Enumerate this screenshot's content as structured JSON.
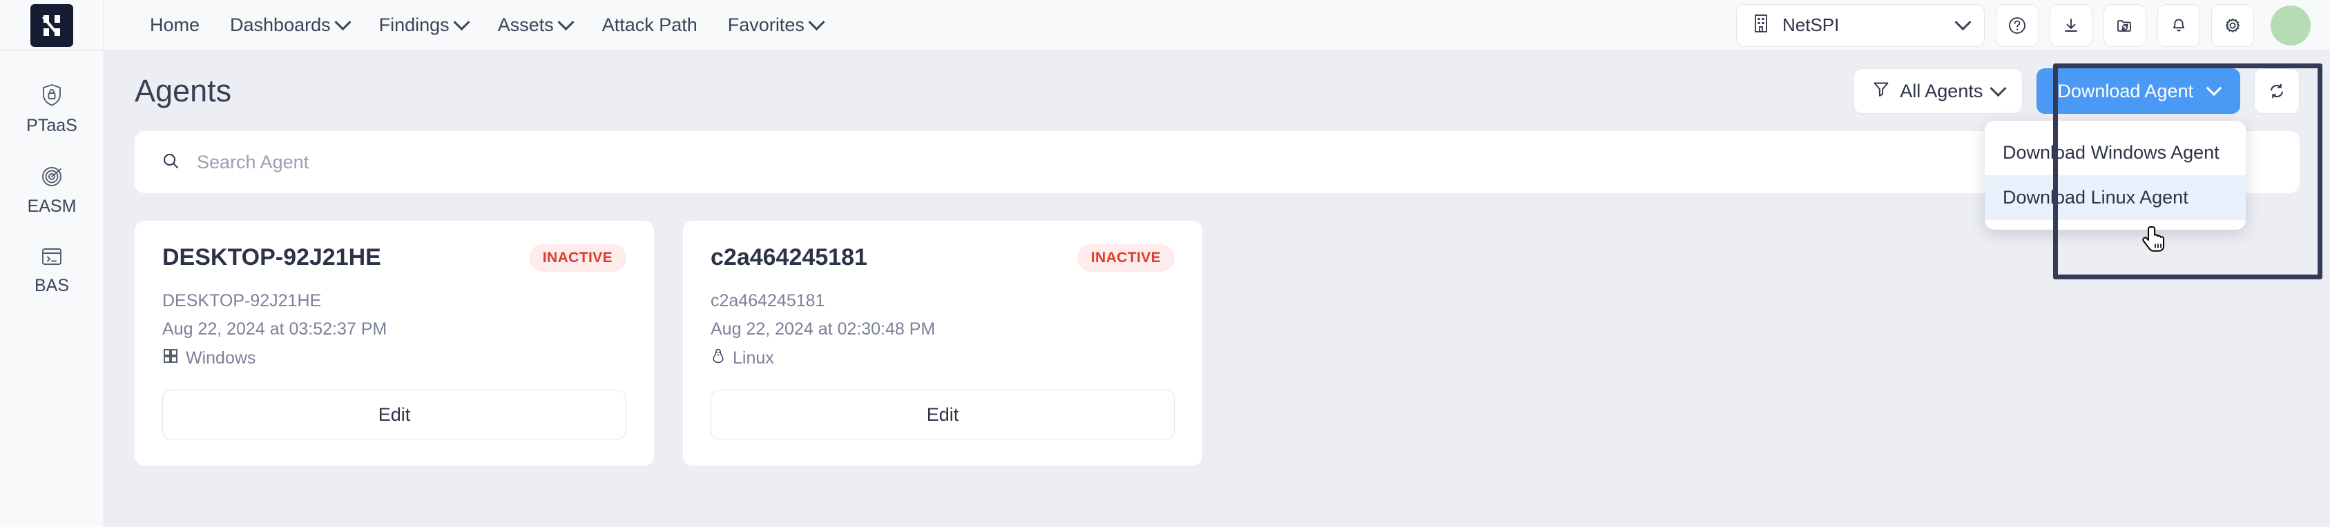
{
  "brand": {
    "logo_icon": "netspi-n-logo"
  },
  "nav": {
    "items": [
      {
        "label": "Home",
        "caret": false
      },
      {
        "label": "Dashboards",
        "caret": true
      },
      {
        "label": "Findings",
        "caret": true
      },
      {
        "label": "Assets",
        "caret": true
      },
      {
        "label": "Attack Path",
        "caret": false
      },
      {
        "label": "Favorites",
        "caret": true
      }
    ]
  },
  "topbar_right": {
    "org": {
      "name": "NetSPI",
      "icon": "building-icon",
      "caret_icon": "chevron-down-icon"
    },
    "icons": [
      {
        "name": "help-icon"
      },
      {
        "name": "download-icon"
      },
      {
        "name": "folder-sync-icon"
      },
      {
        "name": "bell-icon"
      },
      {
        "name": "gear-icon"
      }
    ],
    "avatar": {
      "name": "user-avatar",
      "color": "#b5dcb2"
    }
  },
  "sidebar": {
    "items": [
      {
        "label": "PTaaS",
        "icon": "shield-lock-icon"
      },
      {
        "label": "EASM",
        "icon": "radar-target-icon"
      },
      {
        "label": "BAS",
        "icon": "terminal-icon"
      }
    ]
  },
  "page": {
    "title": "Agents",
    "filter": {
      "label": "All Agents",
      "icon": "filter-funnel-icon",
      "caret_icon": "chevron-down-icon"
    },
    "download_button": {
      "label": "Download Agent",
      "color": "#4a9af5",
      "caret_icon": "chevron-down-icon"
    },
    "download_menu": {
      "items": [
        {
          "label": "Download Windows Agent",
          "hovered": false
        },
        {
          "label": "Download Linux Agent",
          "hovered": true
        }
      ],
      "hover_color": "#e9f1fc"
    },
    "refresh_button": {
      "icon": "refresh-sync-icon"
    },
    "annotation_box": {
      "color": "#353b57"
    },
    "cursor": {
      "icon": "pointer-hand-cursor"
    }
  },
  "search": {
    "placeholder": "Search Agent",
    "value": "",
    "icon": "search-icon"
  },
  "cards": [
    {
      "title": "DESKTOP-92J21HE",
      "status": "INACTIVE",
      "status_color": "#dd3c2d",
      "subtitle": "DESKTOP-92J21HE",
      "date": "Aug 22, 2024 at 03:52:37 PM",
      "os": "Windows",
      "os_icon": "windows-icon",
      "edit_label": "Edit"
    },
    {
      "title": "c2a464245181",
      "status": "INACTIVE",
      "status_color": "#dd3c2d",
      "subtitle": "c2a464245181",
      "date": "Aug 22, 2024 at 02:30:48 PM",
      "os": "Linux",
      "os_icon": "linux-penguin-icon",
      "edit_label": "Edit"
    }
  ]
}
